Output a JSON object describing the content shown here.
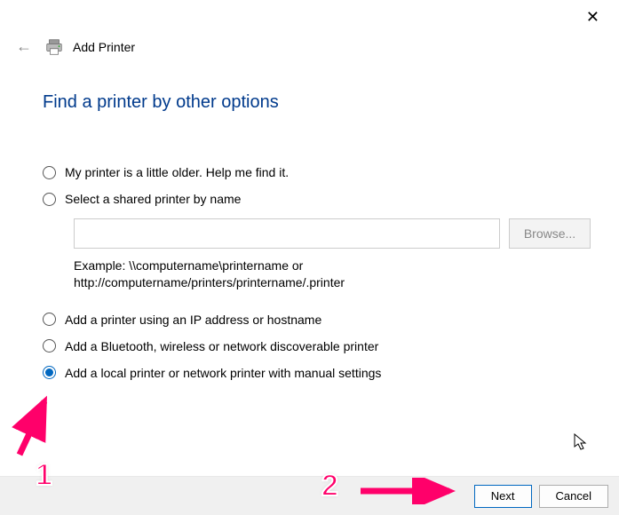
{
  "window": {
    "close_label": "✕"
  },
  "header": {
    "back_arrow": "←",
    "title": "Add Printer"
  },
  "page": {
    "title": "Find a printer by other options"
  },
  "options": {
    "older": {
      "label": "My printer is a little older. Help me find it.",
      "selected": false
    },
    "shared": {
      "label": "Select a shared printer by name",
      "selected": false,
      "input_value": "",
      "browse_label": "Browse...",
      "example_line1": "Example: \\\\computername\\printername or",
      "example_line2": "http://computername/printers/printername/.printer"
    },
    "ip": {
      "label": "Add a printer using an IP address or hostname",
      "selected": false
    },
    "bluetooth": {
      "label": "Add a Bluetooth, wireless or network discoverable printer",
      "selected": false
    },
    "local": {
      "label": "Add a local printer or network printer with manual settings",
      "selected": true
    }
  },
  "footer": {
    "next_label": "Next",
    "cancel_label": "Cancel"
  },
  "annotations": {
    "num1": "1",
    "num2": "2"
  }
}
